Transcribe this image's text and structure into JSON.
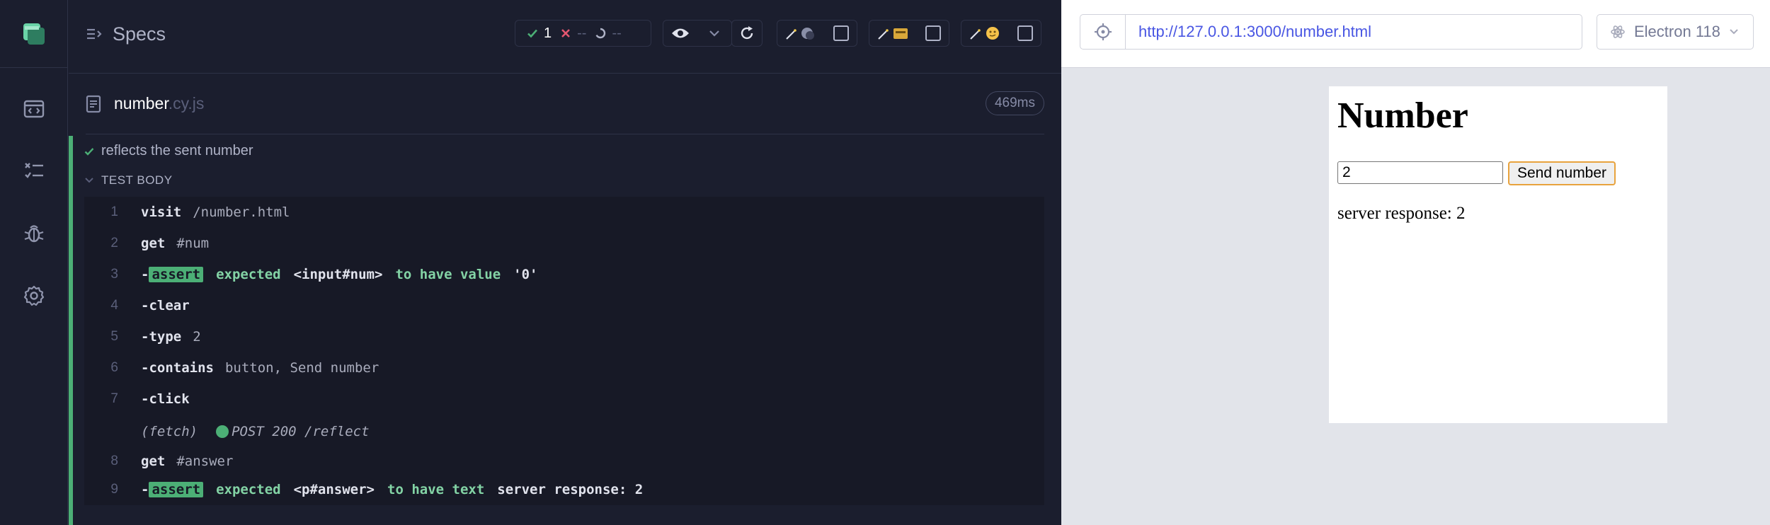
{
  "nav": {
    "items": [
      "specs-nav",
      "runs-nav",
      "debug-nav",
      "settings-nav"
    ]
  },
  "reporter": {
    "specs_label": "Specs",
    "stats": {
      "passed": "1",
      "failed": "--",
      "pending": "--"
    },
    "spec": {
      "name": "number",
      "ext": ".cy.js",
      "duration": "469ms"
    },
    "test_title": "reflects the sent number",
    "test_body_label": "TEST BODY",
    "commands": [
      {
        "num": "1",
        "name": "visit",
        "msg": "/number.html"
      },
      {
        "num": "2",
        "name": "get",
        "msg": "#num"
      },
      {
        "num": "3",
        "name": "assert",
        "expected": "expected",
        "subject": "<input#num>",
        "verb": "to have value",
        "value": "'0'"
      },
      {
        "num": "4",
        "name": "clear"
      },
      {
        "num": "5",
        "name": "type",
        "msg": "2"
      },
      {
        "num": "6",
        "name": "contains",
        "msg": "button, Send number"
      },
      {
        "num": "7",
        "name": "click"
      },
      {
        "num": "",
        "fetch_label": "(fetch)",
        "fetch_req": "POST 200 /reflect"
      },
      {
        "num": "8",
        "name": "get",
        "msg": "#answer"
      },
      {
        "num": "9",
        "name": "assert",
        "expected": "expected",
        "subject": "<p#answer>",
        "verb": "to have text",
        "value": "server response: 2"
      }
    ]
  },
  "aut": {
    "url": "http://127.0.0.1:3000/number.html",
    "browser": "Electron 118",
    "page": {
      "heading": "Number",
      "input_value": "2",
      "button_label": "Send number",
      "answer": "server response: 2"
    }
  },
  "colors": {
    "pass": "#4caf76",
    "url": "#4956e3",
    "bg": "#1b1e2e"
  }
}
